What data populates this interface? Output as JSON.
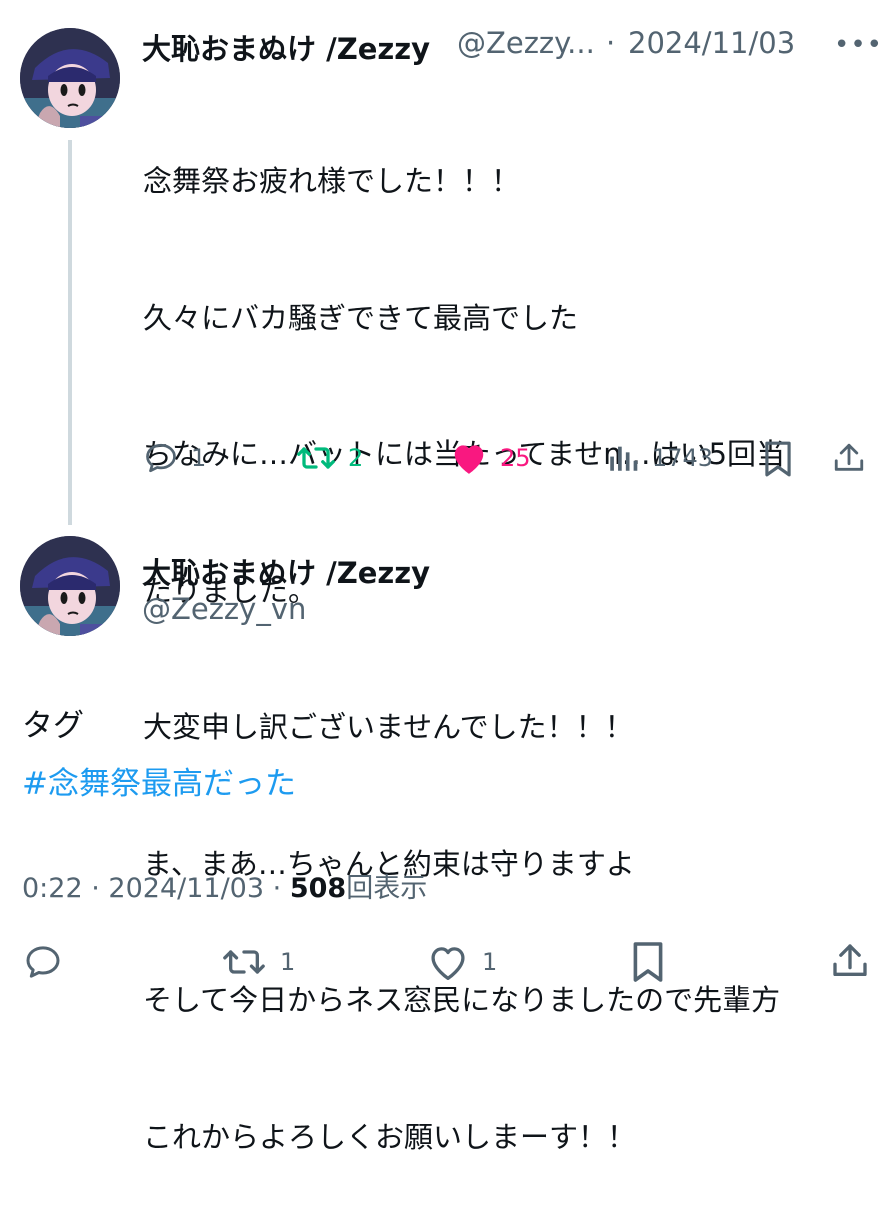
{
  "colors": {
    "text": "#0f1419",
    "muted": "#536471",
    "link": "#1d9bf0",
    "retweet": "#00ba7c",
    "like": "#f91880",
    "thread_line": "#cfd9de"
  },
  "reply_tweet": {
    "display_name": "大恥おまぬけ /Zezzy",
    "handle_truncated": "@Zezzy...",
    "separator": "·",
    "date": "2024/11/03",
    "more_label": "•••",
    "lines": [
      "念舞祭お疲れ様でした！！！",
      "久々にバカ騒ぎできて最高でした",
      "ちなみに…バットには当たってませn…はい5回当",
      "たりました。",
      "大変申し訳ございませんでした！！！",
      "ま、まあ…ちゃんと約束は守りますよ",
      "そして今日からネス窓民になりましたので先輩方",
      "これからよろしくお願いしまーす！！"
    ],
    "stats": {
      "replies": "1",
      "retweets": "2",
      "likes": "25",
      "views": "1743"
    },
    "icons": [
      "reply-icon",
      "retweet-icon",
      "heart-filled-icon",
      "views-icon",
      "bookmark-icon",
      "share-icon"
    ]
  },
  "main_tweet": {
    "display_name": "大恥おまぬけ /Zezzy",
    "handle": "@Zezzy_vn",
    "tag_label": "タグ",
    "hashtag": "#念舞祭最高だった",
    "time": "0:22",
    "separator": "·",
    "date": "2024/11/03",
    "views_count": "508",
    "views_label": "回表示",
    "stats": {
      "retweets": "1",
      "likes": "1"
    },
    "icons": [
      "reply-icon",
      "retweet-icon",
      "heart-icon",
      "bookmark-icon",
      "share-icon"
    ]
  }
}
